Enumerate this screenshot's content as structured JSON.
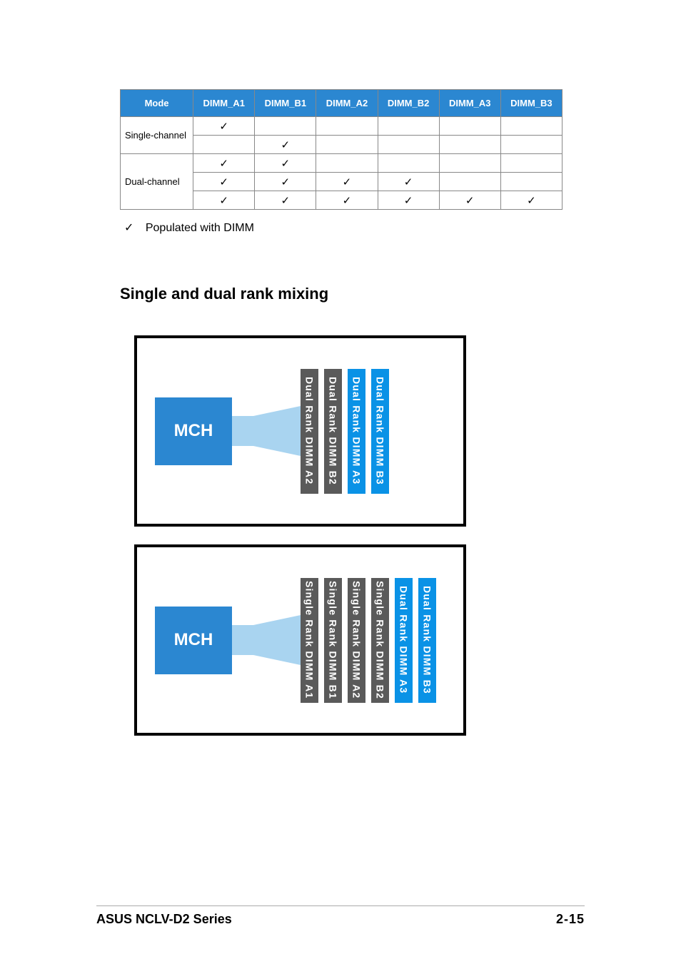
{
  "table": {
    "headers": [
      "Mode",
      "DIMM_A1",
      "DIMM_B1",
      "DIMM_A2",
      "DIMM_B2",
      "DIMM_A3",
      "DIMM_B3"
    ],
    "rows": [
      {
        "mode": "Single-channel",
        "span": 2,
        "cells": [
          "✓",
          "",
          "",
          "",
          "",
          ""
        ]
      },
      {
        "mode": "",
        "span": 0,
        "cells": [
          "",
          "✓",
          "",
          "",
          "",
          ""
        ]
      },
      {
        "mode": "Dual-channel",
        "span": 3,
        "cells": [
          "✓",
          "✓",
          "",
          "",
          "",
          ""
        ]
      },
      {
        "mode": "",
        "span": 0,
        "cells": [
          "✓",
          "✓",
          "✓",
          "✓",
          "",
          ""
        ]
      },
      {
        "mode": "",
        "span": 0,
        "cells": [
          "✓",
          "✓",
          "✓",
          "✓",
          "✓",
          "✓"
        ]
      }
    ]
  },
  "legend": {
    "symbol": "✓",
    "text": "Populated with DIMM"
  },
  "section_title": "Single and dual rank mixing",
  "diagrams": [
    {
      "mch": "MCH",
      "slots": [
        {
          "label": "Dual Rank DIMM A2",
          "color": "grey"
        },
        {
          "label": "Dual Rank DIMM B2",
          "color": "grey"
        },
        {
          "label": "Dual Rank DIMM A3",
          "color": "blue"
        },
        {
          "label": "Dual Rank DIMM B3",
          "color": "blue"
        }
      ]
    },
    {
      "mch": "MCH",
      "slots": [
        {
          "label": "Single Rank DIMM A1",
          "color": "grey"
        },
        {
          "label": "Single Rank DIMM B1",
          "color": "grey"
        },
        {
          "label": "Single Rank DIMM A2",
          "color": "grey"
        },
        {
          "label": "Single Rank DIMM B2",
          "color": "grey"
        },
        {
          "label": "Dual Rank DIMM A3",
          "color": "blue"
        },
        {
          "label": "Dual Rank DIMM B3",
          "color": "blue"
        }
      ]
    }
  ],
  "footer": {
    "left": "ASUS NCLV-D2 Series",
    "right": "2-15"
  }
}
